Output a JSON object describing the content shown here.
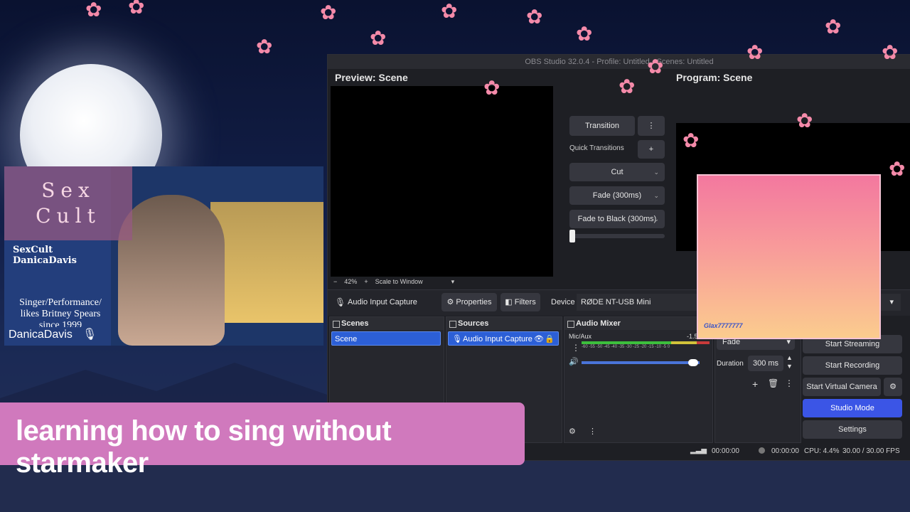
{
  "obs": {
    "window_title": "OBS Studio 32.0.4 - Profile: Untitled - Scenes: Untitled",
    "preview_title": "Preview: Scene",
    "program_title": "Program: Scene",
    "zoom": "42%",
    "scale_mode": "Scale to Window",
    "transition_button": "Transition",
    "quick_transitions_label": "Quick Transitions",
    "quick_transitions": [
      "Cut",
      "Fade (300ms)",
      "Fade to Black (300ms)"
    ],
    "source_name": "Audio Input Capture",
    "properties_label": "Properties",
    "filters_label": "Filters",
    "device_label": "Device",
    "device_value": "RØDE NT-USB Mini",
    "docks": {
      "scenes": {
        "title": "Scenes",
        "items": [
          "Scene"
        ]
      },
      "sources": {
        "title": "Sources",
        "items": [
          "Audio Input Capture"
        ]
      },
      "mixer": {
        "title": "Audio Mixer",
        "channel": "Mic/Aux",
        "level": "-1.5",
        "scale": "-60 -55 -50 -45 -40 -35 -30 -25 -20 -15 -10 -5 0"
      },
      "transitions": {
        "type": "Fade",
        "duration_label": "Duration",
        "duration_value": "300 ms"
      }
    },
    "controls": {
      "start_streaming": "Start Streaming",
      "start_recording": "Start Recording",
      "start_virtual_camera": "Start Virtual Camera",
      "studio_mode": "Studio Mode",
      "settings": "Settings"
    },
    "status": {
      "stream_time": "00:00:00",
      "record_time": "00:00:00",
      "cpu": "CPU: 4.4%",
      "fps": "30.00 / 30.00 FPS"
    }
  },
  "profile": {
    "logo_text": "Sex Cult",
    "name": "SexCult DanicaDavis",
    "bio_line1": "Singer/Performance/",
    "bio_line2": "likes Britney Spears",
    "bio_line3": "since 1999",
    "username": "DanicaDavis"
  },
  "overlay_user": "Glax7777777",
  "caption": "learning how to sing without starmaker",
  "colors": {
    "caption_bg": "#d079bd",
    "studio_mode": "#3b55e6",
    "blossom": "#f48aa9"
  }
}
